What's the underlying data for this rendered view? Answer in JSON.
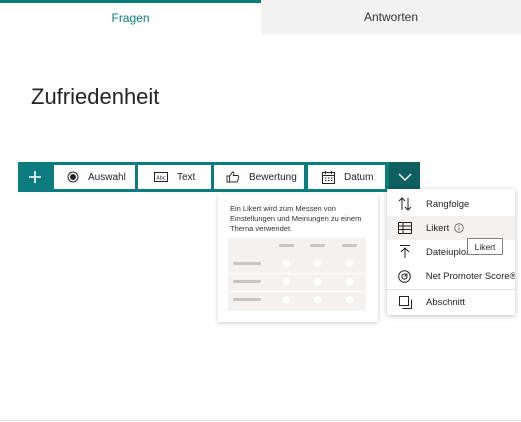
{
  "tabs": [
    {
      "label": "Fragen",
      "active": true
    },
    {
      "label": "Antworten",
      "active": false
    }
  ],
  "form": {
    "title": "Zufriedenheit"
  },
  "toolbar": {
    "add_icon": "plus-icon",
    "buttons": [
      {
        "label": "Auswahl",
        "icon": "radio-icon"
      },
      {
        "label": "Text",
        "icon": "text-icon"
      },
      {
        "label": "Bewertung",
        "icon": "thumbs-up-icon"
      },
      {
        "label": "Datum",
        "icon": "calendar-icon"
      }
    ],
    "more_icon": "chevron-down-icon"
  },
  "preview": {
    "description": "Ein Likert wird zum Messen von Einstellungen und Meinungen zu einem Thema verwendet."
  },
  "dropdown": {
    "items": [
      {
        "label": "Rangfolge",
        "icon": "ranking-icon"
      },
      {
        "label": "Likert",
        "icon": "likert-grid-icon",
        "highlighted": true
      },
      {
        "label": "Dateiupload",
        "icon": "upload-icon"
      },
      {
        "label": "Net Promoter Score®",
        "icon": "nps-icon"
      },
      {
        "label": "Abschnitt",
        "icon": "section-icon"
      }
    ]
  },
  "tooltip": {
    "text": "Likert"
  },
  "colors": {
    "accent": "#0a7c7e",
    "accent_dark": "#0d5f60",
    "tab_inactive_bg": "#f2f2f2"
  }
}
